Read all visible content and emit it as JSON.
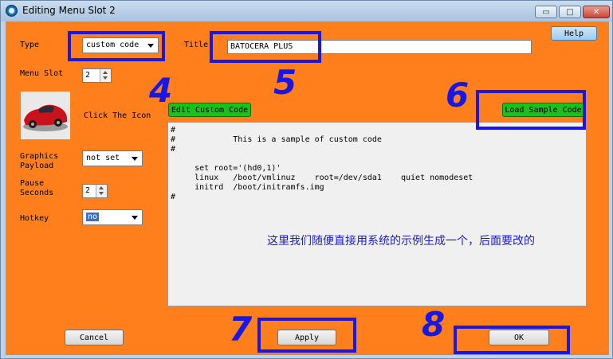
{
  "window": {
    "title": "Editing Menu Slot 2",
    "minimize_glyph": "▭",
    "maximize_glyph": "□",
    "close_glyph": "✕"
  },
  "form": {
    "type_label": "Type",
    "type_value": "custom code",
    "title_label": "Title",
    "title_value": "BATOCERA PLUS",
    "menu_slot_label": "Menu Slot",
    "menu_slot_value": "2",
    "icon_hint": "Click The Icon",
    "graphics_payload_label": "Graphics\nPayload",
    "graphics_payload_value": "not set",
    "pause_seconds_label": "Pause\nSeconds",
    "pause_seconds_value": "2",
    "hotkey_label": "Hotkey",
    "hotkey_value": "no"
  },
  "buttons": {
    "help": "Help",
    "edit_custom_code": "Edit Custom Code",
    "load_sample_code": "Load Sample Code",
    "cancel": "Cancel",
    "apply": "Apply",
    "ok": "OK"
  },
  "code": {
    "text": "#\n#            This is a sample of custom code\n#\n\n     set root='(hd0,1)'\n     linux   /boot/vmlinuz    root=/dev/sda1    quiet nomodeset\n     initrd  /boot/initramfs.img\n#"
  },
  "annotations": {
    "n4": "4",
    "n5": "5",
    "n6": "6",
    "n7": "7",
    "n8": "8",
    "note": "这里我们随便直接用系统的示例生成一个，后面要改的"
  },
  "colors": {
    "client_bg": "#ff7f1c",
    "annotation": "#1717e6",
    "green_button": "#19c219"
  }
}
